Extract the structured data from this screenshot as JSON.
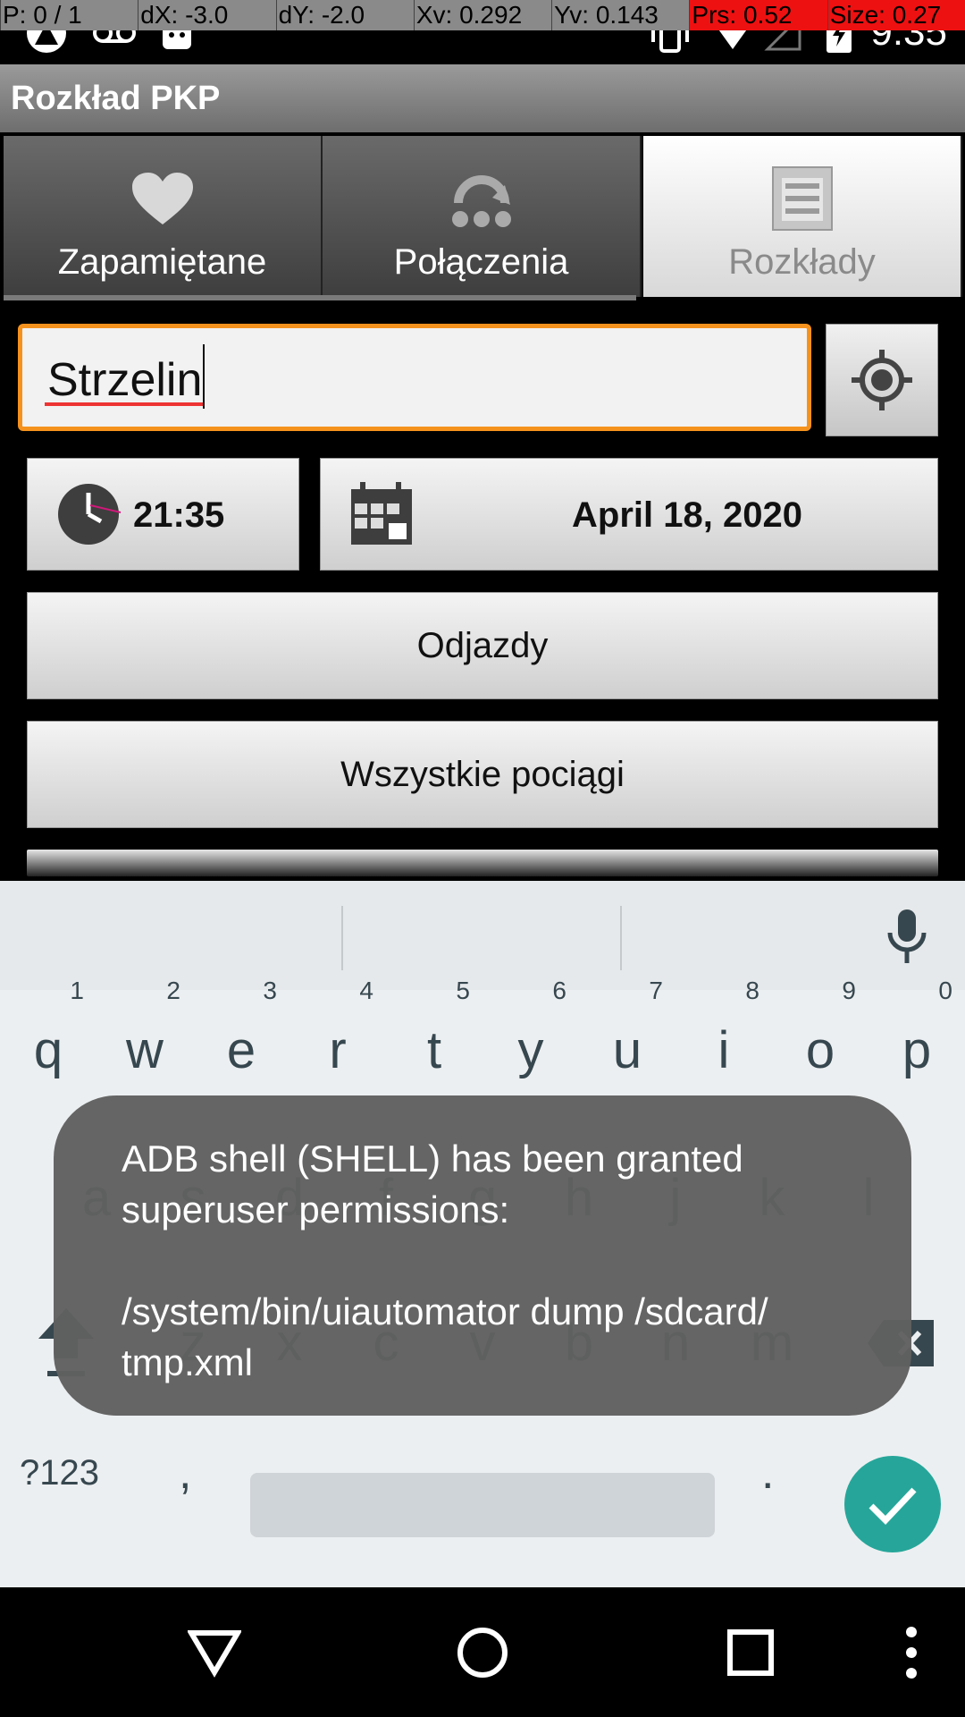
{
  "debug_overlay": {
    "p": "P: 0 / 1",
    "dx": "dX: -3.0",
    "dy": "dY: -2.0",
    "xv": "Xv: 0.292",
    "yv": "Yv: 0.143",
    "prs": "Prs: 0.52",
    "size": "Size: 0.27"
  },
  "status_bar": {
    "time": "9:35"
  },
  "app": {
    "title": "Rozkład PKP"
  },
  "tabs": [
    {
      "label": "Zapamiętane",
      "icon": "heart-icon",
      "active": false
    },
    {
      "label": "Połączenia",
      "icon": "connections-icon",
      "active": false
    },
    {
      "label": "Rozkłady",
      "icon": "timetable-icon",
      "active": true
    }
  ],
  "form": {
    "station_value": "Strzelin",
    "time": "21:35",
    "date": "April 18, 2020",
    "departures_label": "Odjazdy",
    "all_trains_label": "Wszystkie pociągi"
  },
  "keyboard": {
    "row1": [
      "q",
      "w",
      "e",
      "r",
      "t",
      "y",
      "u",
      "i",
      "o",
      "p"
    ],
    "row1_hints": [
      "1",
      "2",
      "3",
      "4",
      "5",
      "6",
      "7",
      "8",
      "9",
      "0"
    ],
    "row2": [
      "a",
      "s",
      "d",
      "f",
      "g",
      "h",
      "j",
      "k",
      "l"
    ],
    "row3": [
      "z",
      "x",
      "c",
      "v",
      "b",
      "n",
      "m"
    ],
    "symbols_label": "?123",
    "comma": ",",
    "period": "."
  },
  "toast": {
    "message": "ADB shell (SHELL) has been granted\nsuperuser permissions:\n\n/system/bin/uiautomator dump /sdcard/\ntmp.xml"
  },
  "colors": {
    "focus_orange": "#f5921e",
    "enter_teal": "#26a69a",
    "debug_red": "#e11111"
  }
}
